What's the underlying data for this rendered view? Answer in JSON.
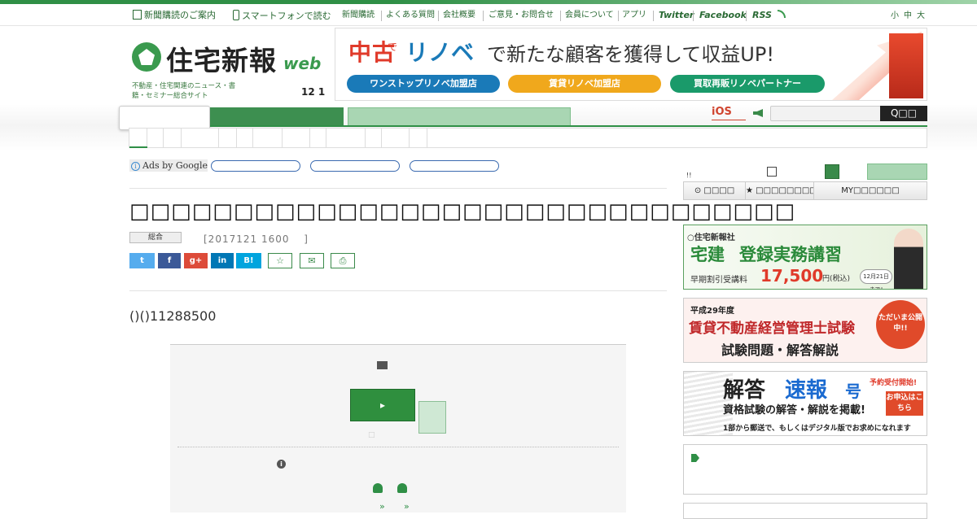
{
  "topbar": {
    "subscribe_guide": "新聞購読のご案内",
    "smartphone": "スマートフォンで読む",
    "links": [
      "新聞購読",
      "よくある質問",
      "会社概要",
      "ご意見・お問合せ",
      "会員について",
      "アプリ"
    ],
    "twitter": "Twitter",
    "facebook": "Facebook",
    "rss": "RSS",
    "font_small": "小",
    "font_medium": "中",
    "font_large": "大"
  },
  "logo": {
    "name": "住宅新報",
    "web": "web",
    "tagline": "不動産・住宅関連のニュース・書籍・セミナー総合サイト",
    "date": "12 1"
  },
  "banner": {
    "part1": "中古",
    "part2": "で",
    "part3": "リノベ",
    "part4": "で新たな顧客を獲得して収益UP!",
    "btn1": "ワンストップリノベ加盟店",
    "btn2": "賃貸リノベ加盟店",
    "btn3": "買取再販リノベパートナー",
    "up": "UP"
  },
  "nav": {
    "ios": "iOS",
    "search_button": "Q□□"
  },
  "ads": {
    "label": "Ads by Google"
  },
  "article": {
    "title": "□□□□□□□□□□□□□□□□□□□□□□□□□□□□□□□□",
    "category": "総合",
    "date": "[2017121 1600　 ]",
    "lead": "()()11288500",
    "note_char": "□"
  },
  "share": {
    "twitter": "t",
    "facebook": "f",
    "gplus": "g+",
    "linkedin": "in",
    "hatena": "B!",
    "star": "☆",
    "mail": "✉",
    "print": "⎙"
  },
  "sidebar": {
    "marks": "!!",
    "tab1": "⊙ □□□□",
    "tab2": "★ □□□□□□□□",
    "tab3": "MY□□□□□□",
    "banner1": {
      "company": "○住宅新報社",
      "title_a": "宅建",
      "title_b": "登録実務講習",
      "sub": "早期割引受講料",
      "price": "17,500",
      "unit": "円(税込)",
      "deadline": "12月21日まで!"
    },
    "banner2": {
      "year": "平成29年度",
      "title": "賃貸不動産経営管理士試験",
      "sub": "試験問題・解答解説",
      "badge": "ただいま公開中!!"
    },
    "banner3": {
      "title_a": "解答",
      "title_b": "速報",
      "title_c": "号",
      "reserve": "予約受付開始!",
      "apply": "お申込はこちら",
      "line1": "資格試験の解答・解説を掲載!",
      "line2": "1部から郵送で、もしくはデジタル版でお求めになれます"
    }
  },
  "colors": {
    "brand_green": "#2f8f46",
    "accent_red": "#d0442e",
    "light_green": "#a9d6b3"
  }
}
